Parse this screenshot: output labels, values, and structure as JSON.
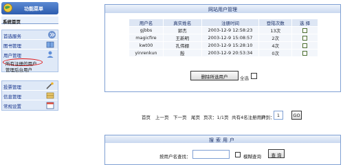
{
  "sidebar": {
    "header_title": "功能菜单",
    "home": "系统首页",
    "group1": [
      {
        "label": "首选服务",
        "icon": "double-chevron-icon"
      },
      {
        "label": "图书管理",
        "icon": "book-icon"
      },
      {
        "label": "用户管理",
        "icon": "user-icon"
      }
    ],
    "user_sub": [
      "所有注册的用户",
      "管理后台用户"
    ],
    "group2": [
      {
        "label": "投票管理",
        "icon": "tools-icon"
      },
      {
        "label": "信息管理",
        "icon": "drawer-icon"
      },
      {
        "label": "常规设置",
        "icon": "calendar-icon"
      }
    ]
  },
  "panel": {
    "title": "网站用户管理",
    "columns": [
      "用户名",
      "真实姓名",
      "注册时间",
      "登陆次数",
      "选 择"
    ],
    "rows": [
      [
        "gjbbs",
        "郭杰",
        "2003-12-9 12:58:23",
        "13次"
      ],
      [
        "magicfire",
        "王新明",
        "2003-12-9 15:08:57",
        "2次"
      ],
      [
        "kwt00",
        "孔伟棚",
        "2003-12-9 15:28:10",
        "4次"
      ],
      [
        "yinrenkun",
        "殷",
        "2003-12-9 20:53:34",
        "0次"
      ]
    ],
    "delete_label": "删除所选用户",
    "select_all_label": "全选"
  },
  "pager": {
    "first": "首页",
    "prev": "上一页",
    "next": "下一页",
    "last": "尾页",
    "page_info": "页次：1/1页",
    "total": "共有4名注册用户",
    "jump_label": "转到：",
    "page_value": "1",
    "go_label": "GO"
  },
  "search": {
    "title": "搜索用户",
    "label": "按用户名查找：",
    "fuzzy_label": "模糊查询",
    "query_label": "查 询"
  },
  "colors": {
    "header_blue": "#2d5cae",
    "border_blue": "#7e9fd3",
    "highlight_red": "#e01010"
  }
}
